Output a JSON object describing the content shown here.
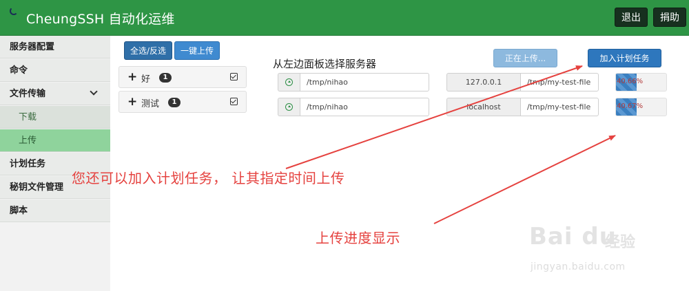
{
  "app": {
    "title": "CheungSSH 自动化运维",
    "logout_label": "退出",
    "donate_label": "捐助"
  },
  "sidebar": {
    "items": [
      {
        "label": "服务器配置"
      },
      {
        "label": "命令"
      },
      {
        "label": "文件传输"
      },
      {
        "label": "下载"
      },
      {
        "label": "上传"
      },
      {
        "label": "计划任务"
      },
      {
        "label": "秘钥文件管理"
      },
      {
        "label": "脚本"
      }
    ]
  },
  "toolbar": {
    "select_all_label": "全选/反选",
    "one_click_upload_label": "一键上传",
    "uploading_label": "正在上传...",
    "add_task_label": "加入计划任务"
  },
  "groups": [
    {
      "plus": "+",
      "name": "好",
      "count": "1"
    },
    {
      "plus": "+",
      "name": "测试",
      "count": "1"
    }
  ],
  "panel_heading": "从左边面板选择服务器",
  "upload_rows": [
    {
      "source": "/tmp/nihao",
      "host": "127.0.0.1",
      "dest": "/tmp/my-test-file",
      "progress_text": "40.66%",
      "progress": 0.41
    },
    {
      "source": "/tmp/nihao",
      "host": "localhost",
      "dest": "/tmp/my-test-file",
      "progress_text": "40.67%",
      "progress": 0.41
    }
  ],
  "annotations": {
    "schedule_note": "您还可以加入计划任务， 让其指定时间上传",
    "progress_note": "上传进度显示",
    "color": "#e5423f"
  },
  "watermark": {
    "logo": "Bai du",
    "cn": "经验",
    "url": "jingyan.baidu.com"
  }
}
